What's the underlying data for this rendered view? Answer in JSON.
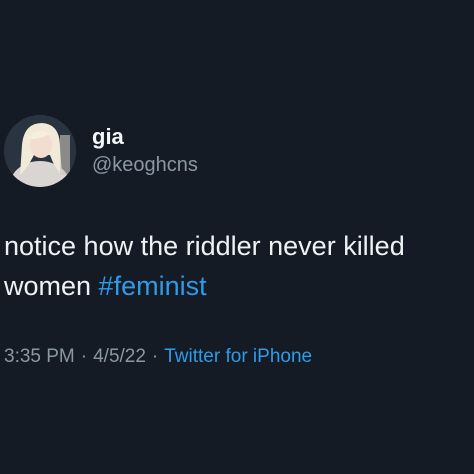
{
  "author": {
    "display_name": "gia",
    "handle": "@keoghcns",
    "avatar_icon": "profile-photo"
  },
  "tweet": {
    "text_line1": "notice how the riddler never killed",
    "text_line2_plain": "women ",
    "hashtag": "#feminist"
  },
  "meta": {
    "time": "3:35 PM",
    "date": "4/5/22",
    "separator": "·",
    "source": "Twitter for iPhone"
  },
  "colors": {
    "background": "#141b25",
    "link": "#2f9be8",
    "muted": "#8b97a3",
    "text": "#eef2f5"
  }
}
